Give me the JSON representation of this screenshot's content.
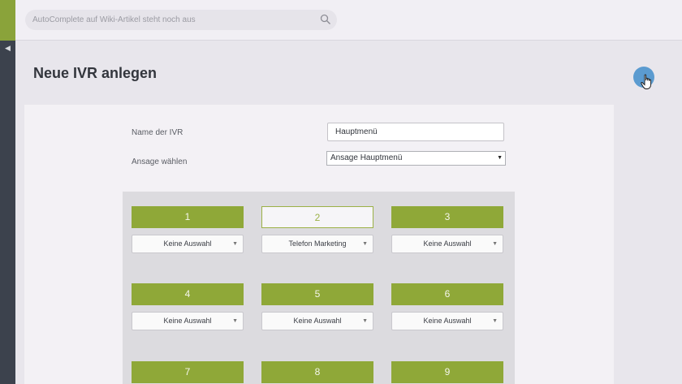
{
  "search": {
    "placeholder": "AutoComplete auf Wiki-Artikel steht noch aus"
  },
  "page": {
    "title": "Neue IVR anlegen"
  },
  "form": {
    "name_label": "Name der IVR",
    "name_value": "Hauptmenü",
    "ansage_label": "Ansage wählen",
    "ansage_value": "Ansage Hauptmenü"
  },
  "keys": [
    {
      "label": "1",
      "selection": "Keine Auswahl"
    },
    {
      "label": "2",
      "selection": "Telefon Marketing"
    },
    {
      "label": "3",
      "selection": "Keine Auswahl"
    },
    {
      "label": "4",
      "selection": "Keine Auswahl"
    },
    {
      "label": "5",
      "selection": "Keine Auswahl"
    },
    {
      "label": "6",
      "selection": "Keine Auswahl"
    },
    {
      "label": "7"
    },
    {
      "label": "8"
    },
    {
      "label": "9"
    }
  ],
  "colors": {
    "accent": "#8fa838",
    "sidebar": "#3c424d",
    "help_button": "#5b9bd0"
  }
}
